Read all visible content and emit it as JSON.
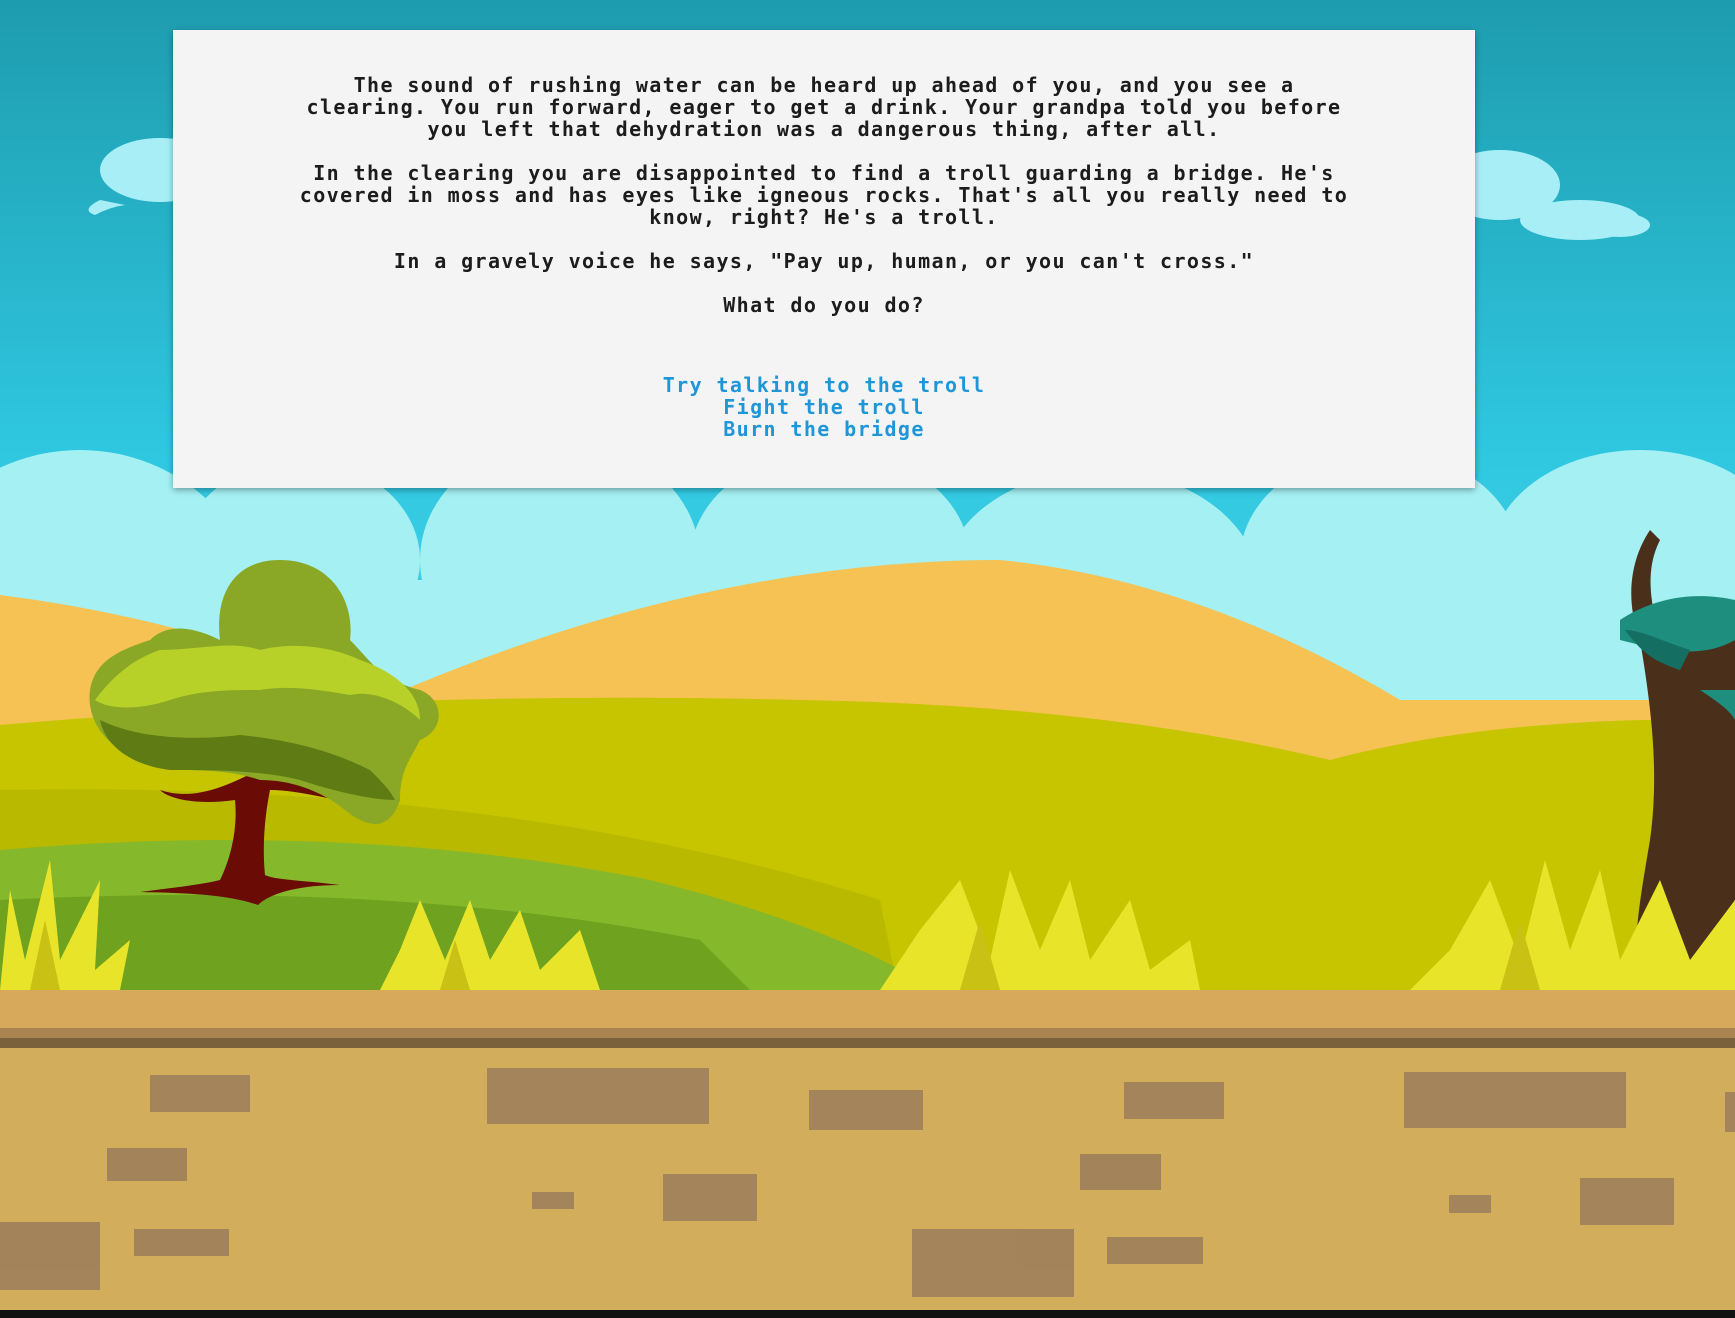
{
  "story": {
    "paragraphs": [
      "The sound of rushing water can be heard up ahead of you, and you see a clearing. You run forward, eager to get a drink. Your grandpa told you before you left that dehydration was a dangerous thing, after all.",
      "In the clearing you are disappointed to find a troll guarding a bridge. He's covered in moss and has eyes like igneous rocks. That's all you really need to know, right? He's a troll.",
      "In a gravely voice he says, \"Pay up, human, or you can't cross.\""
    ],
    "question": "What do you do?"
  },
  "choices": [
    {
      "label": "Try talking to the troll"
    },
    {
      "label": "Fight the troll"
    },
    {
      "label": "Burn the bridge"
    }
  ],
  "colors": {
    "panel_background": "#f4f4f4",
    "story_text": "#1c1c1c",
    "choice_link": "#1e96d8",
    "sky_top": "#1e9fb0",
    "sky_bottom": "#4fdcef",
    "ground": "#d4ad5c"
  }
}
